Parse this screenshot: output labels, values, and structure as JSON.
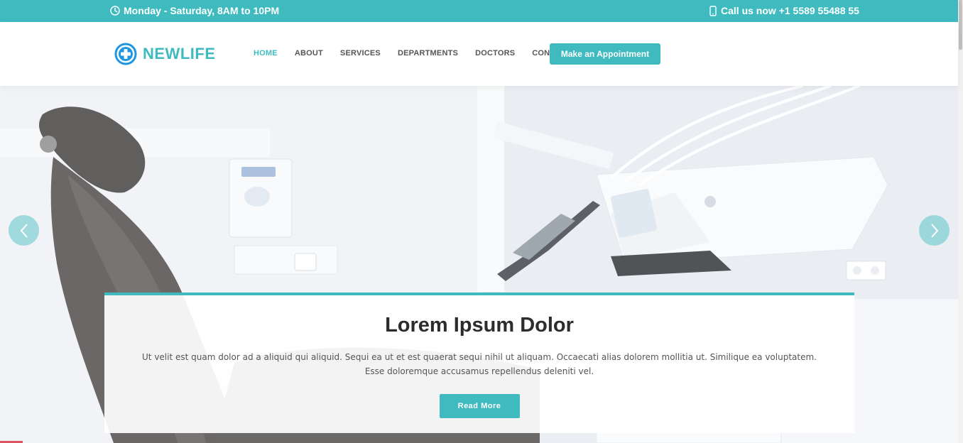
{
  "colors": {
    "accent": "#3fbbc0",
    "text_dark": "#2c2c2c",
    "text_body": "#555555"
  },
  "topbar": {
    "hours_icon": "clock-icon",
    "hours_text": "Monday - Saturday, 8AM to 10PM",
    "phone_icon": "mobile-phone-icon",
    "phone_text": "Call us now +1 5589 55488 55"
  },
  "header": {
    "logo_icon": "medical-cross-icon",
    "logo_text": "NEWLIFE",
    "nav": [
      {
        "label": "HOME",
        "active": true
      },
      {
        "label": "ABOUT",
        "active": false
      },
      {
        "label": "SERVICES",
        "active": false
      },
      {
        "label": "DEPARTMENTS",
        "active": false
      },
      {
        "label": "DOCTORS",
        "active": false
      },
      {
        "label": "CONTACT",
        "active": false
      }
    ],
    "appointment_label": "Make an Appointment"
  },
  "hero": {
    "prev_icon": "chevron-left-icon",
    "next_icon": "chevron-right-icon",
    "title": "Lorem Ipsum Dolor",
    "text": "Ut velit est quam dolor ad a aliquid qui aliquid. Sequi ea ut et est quaerat sequi nihil ut aliquam. Occaecati alias dolorem mollitia ut. Similique ea voluptatem. Esse doloremque accusamus repellendus deleniti vel.",
    "button_label": "Read More"
  }
}
